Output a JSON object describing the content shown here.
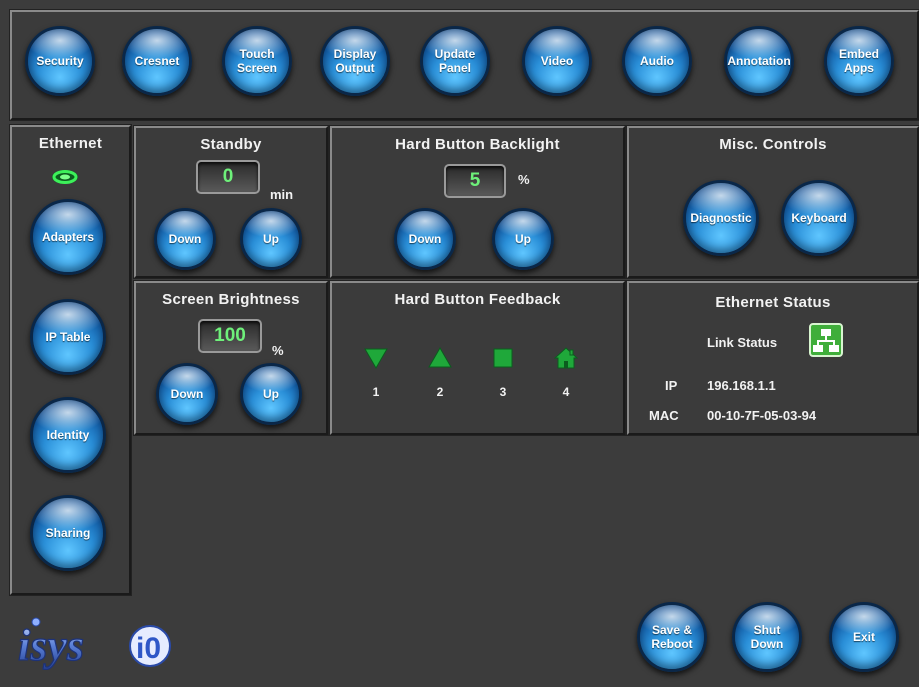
{
  "topbar": {
    "buttons": [
      "Security",
      "Cresnet",
      "Touch\nScreen",
      "Display\nOutput",
      "Update\nPanel",
      "Video",
      "Audio",
      "Annotation",
      "Embed\nApps"
    ]
  },
  "sidebar": {
    "title": "Ethernet",
    "items": [
      "Adapters",
      "IP Table",
      "Identity",
      "Sharing"
    ]
  },
  "standby": {
    "title": "Standby",
    "value": "0",
    "unit": "min",
    "down": "Down",
    "up": "Up"
  },
  "backlight": {
    "title": "Hard Button Backlight",
    "value": "5",
    "unit": "%",
    "down": "Down",
    "up": "Up"
  },
  "misc": {
    "title": "Misc. Controls",
    "diagnostic": "Diagnostic",
    "keyboard": "Keyboard"
  },
  "brightness": {
    "title": "Screen Brightness",
    "value": "100",
    "unit": "%",
    "down": "Down",
    "up": "Up"
  },
  "feedback": {
    "title": "Hard Button Feedback",
    "buttons": [
      "1",
      "2",
      "3",
      "4"
    ]
  },
  "ethernet_status": {
    "title": "Ethernet Status",
    "link_label": "Link Status",
    "ip_label": "IP",
    "ip_value": "196.168.1.1",
    "mac_label": "MAC",
    "mac_value": "00-10-7F-05-03-94"
  },
  "footer": {
    "save": "Save &\nReboot",
    "shutdown": "Shut\nDown",
    "exit": "Exit",
    "logo": "isysi/o"
  },
  "colors": {
    "orb": "#2a8fd8",
    "value_text": "#6ef07a",
    "feedback_green": "#1fa83a",
    "link_icon": "#3fae3a"
  }
}
